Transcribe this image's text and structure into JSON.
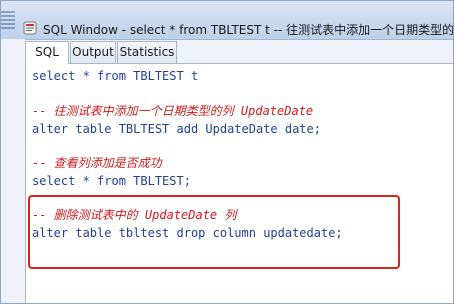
{
  "window": {
    "title": "SQL Window - select * from TBLTEST t -- 往测试表中添加一个日期类型的列",
    "icon": "sql-window-icon"
  },
  "tabs": [
    {
      "label": "SQL",
      "active": true
    },
    {
      "label": "Output",
      "active": false
    },
    {
      "label": "Statistics",
      "active": false
    }
  ],
  "editor": {
    "lines": [
      {
        "text": "select * from TBLTEST t",
        "kind": "code"
      },
      {
        "text": "-- 往测试表中添加一个日期类型的列 UpdateDate",
        "kind": "comment"
      },
      {
        "text": "alter table TBLTEST add UpdateDate date;",
        "kind": "code"
      },
      {
        "text": "-- 查看列添加是否成功",
        "kind": "comment"
      },
      {
        "text": "select * from TBLTEST;",
        "kind": "code"
      },
      {
        "text": "-- 删除测试表中的 UpdateDate 列",
        "kind": "comment"
      },
      {
        "text": "alter table tbltest drop column updatedate;",
        "kind": "code"
      }
    ]
  },
  "colors": {
    "code": "#1f3fa0",
    "comment": "#d01a1a",
    "highlight_border": "#e0211b"
  }
}
